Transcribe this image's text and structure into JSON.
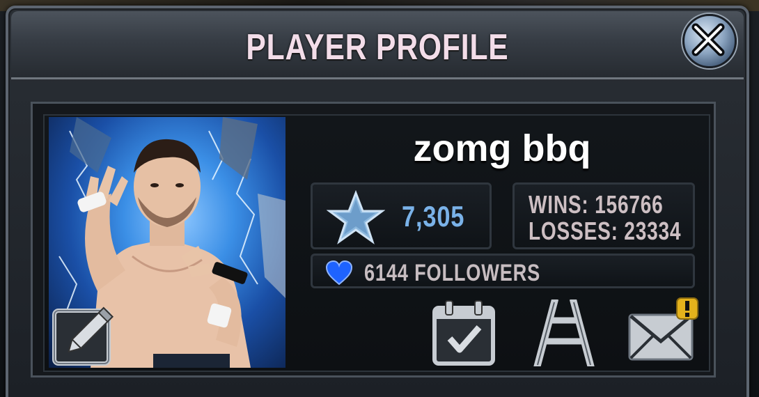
{
  "dialog": {
    "title": "PLAYER PROFILE",
    "close_icon": "close-x-icon"
  },
  "player": {
    "name": "zomg bbq",
    "rating": "7,305",
    "rating_icon": "star-icon",
    "wins_text": "WINS: 156766",
    "losses_text": "LOSSES: 23334",
    "followers_text": "6144 FOLLOWERS",
    "followers_icon": "heart-icon"
  },
  "actions": {
    "edit_icon": "edit-pencil-icon",
    "calendar_icon": "calendar-check-icon",
    "ladder_icon": "ladder-icon",
    "mail_icon": "mail-envelope-icon",
    "mail_alert_icon": "exclamation-badge-icon"
  },
  "colors": {
    "title": "#f3dde9",
    "rating": "#7ab2e8",
    "record": "#cdbfc3",
    "heart": "#1e63ff"
  }
}
